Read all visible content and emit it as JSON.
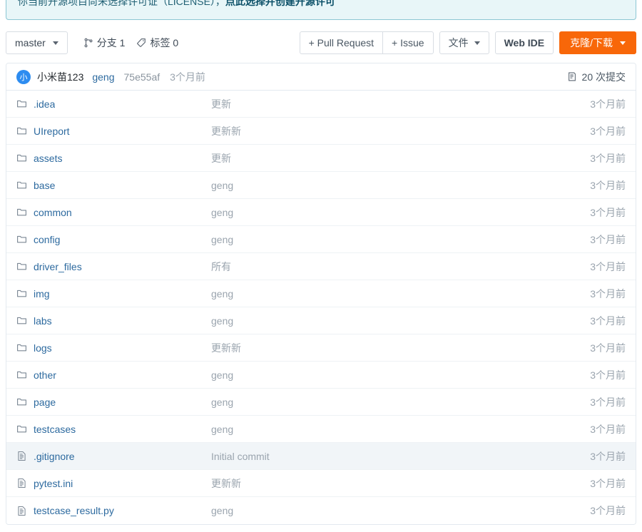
{
  "banner": {
    "text_before": "你当前开源项目尚未选择许可证（LICENSE），",
    "link_text": "点此选择并创建开源许可",
    "bg_color": "#e8f6f8",
    "border_color": "#8cc7d4",
    "link_color": "#0b5068"
  },
  "toolbar": {
    "branch_label": "master",
    "branches_label": "分支 1",
    "tags_label": "标签 0",
    "pull_request_label": "+ Pull Request",
    "issue_label": "+ Issue",
    "file_label": "文件",
    "web_ide_label": "Web IDE",
    "clone_label": "克隆/下载",
    "clone_bg_color": "#f86709"
  },
  "commit_bar": {
    "avatar_initial": "小",
    "avatar_color": "#2d8cf0",
    "author": "小米苗123",
    "message": "geng",
    "sha": "75e55af",
    "time": "3个月前",
    "commit_count_label": "20 次提交"
  },
  "files": [
    {
      "name": ".idea",
      "type": "folder",
      "message": "更新",
      "time": "3个月前",
      "hovered": false
    },
    {
      "name": "UIreport",
      "type": "folder",
      "message": "更新新",
      "time": "3个月前",
      "hovered": false
    },
    {
      "name": "assets",
      "type": "folder",
      "message": "更新",
      "time": "3个月前",
      "hovered": false
    },
    {
      "name": "base",
      "type": "folder",
      "message": "geng",
      "time": "3个月前",
      "hovered": false
    },
    {
      "name": "common",
      "type": "folder",
      "message": "geng",
      "time": "3个月前",
      "hovered": false
    },
    {
      "name": "config",
      "type": "folder",
      "message": "geng",
      "time": "3个月前",
      "hovered": false
    },
    {
      "name": "driver_files",
      "type": "folder",
      "message": "所有",
      "time": "3个月前",
      "hovered": false
    },
    {
      "name": "img",
      "type": "folder",
      "message": "geng",
      "time": "3个月前",
      "hovered": false
    },
    {
      "name": "labs",
      "type": "folder",
      "message": "geng",
      "time": "3个月前",
      "hovered": false
    },
    {
      "name": "logs",
      "type": "folder",
      "message": "更新新",
      "time": "3个月前",
      "hovered": false
    },
    {
      "name": "other",
      "type": "folder",
      "message": "geng",
      "time": "3个月前",
      "hovered": false
    },
    {
      "name": "page",
      "type": "folder",
      "message": "geng",
      "time": "3个月前",
      "hovered": false
    },
    {
      "name": "testcases",
      "type": "folder",
      "message": "geng",
      "time": "3个月前",
      "hovered": false
    },
    {
      "name": ".gitignore",
      "type": "file",
      "message": "Initial commit",
      "time": "3个月前",
      "hovered": true
    },
    {
      "name": "pytest.ini",
      "type": "file",
      "message": "更新新",
      "time": "3个月前",
      "hovered": false
    },
    {
      "name": "testcase_result.py",
      "type": "file",
      "message": "geng",
      "time": "3个月前",
      "hovered": false
    }
  ]
}
